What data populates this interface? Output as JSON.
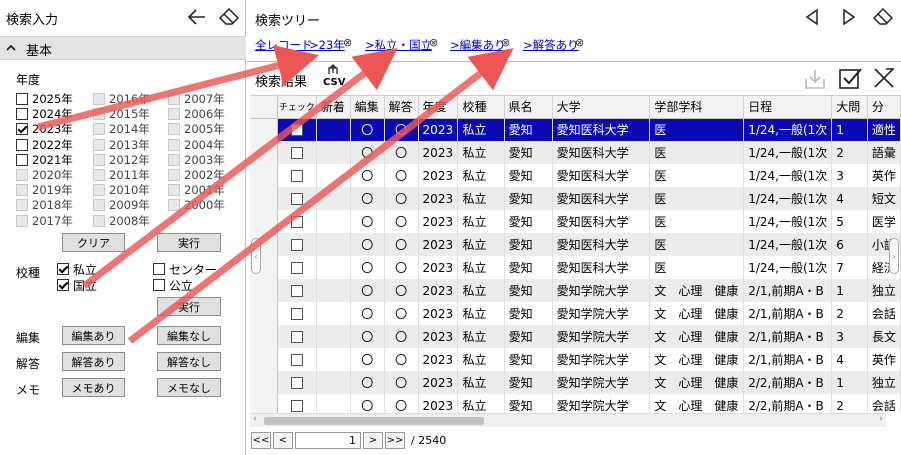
{
  "left": {
    "title": "検索入力",
    "section": "基本",
    "year_label": "年度",
    "years": [
      {
        "label": "2025年",
        "checked": false,
        "enabled": true
      },
      {
        "label": "2024年",
        "checked": false,
        "enabled": true
      },
      {
        "label": "2023年",
        "checked": true,
        "enabled": true
      },
      {
        "label": "2022年",
        "checked": false,
        "enabled": true
      },
      {
        "label": "2021年",
        "checked": false,
        "enabled": true
      },
      {
        "label": "2020年",
        "checked": false,
        "enabled": false
      },
      {
        "label": "2019年",
        "checked": false,
        "enabled": false
      },
      {
        "label": "2018年",
        "checked": false,
        "enabled": false
      },
      {
        "label": "2017年",
        "checked": false,
        "enabled": false
      },
      {
        "label": "2016年",
        "checked": false,
        "enabled": false
      },
      {
        "label": "2015年",
        "checked": false,
        "enabled": false
      },
      {
        "label": "2014年",
        "checked": false,
        "enabled": false
      },
      {
        "label": "2013年",
        "checked": false,
        "enabled": false
      },
      {
        "label": "2012年",
        "checked": false,
        "enabled": false
      },
      {
        "label": "2011年",
        "checked": false,
        "enabled": false
      },
      {
        "label": "2010年",
        "checked": false,
        "enabled": false
      },
      {
        "label": "2009年",
        "checked": false,
        "enabled": false
      },
      {
        "label": "2008年",
        "checked": false,
        "enabled": false
      },
      {
        "label": "2007年",
        "checked": false,
        "enabled": false
      },
      {
        "label": "2006年",
        "checked": false,
        "enabled": false
      },
      {
        "label": "2005年",
        "checked": false,
        "enabled": false
      },
      {
        "label": "2004年",
        "checked": false,
        "enabled": false
      },
      {
        "label": "2003年",
        "checked": false,
        "enabled": false
      },
      {
        "label": "2002年",
        "checked": false,
        "enabled": false
      },
      {
        "label": "2001年",
        "checked": false,
        "enabled": false
      },
      {
        "label": "2000年",
        "checked": false,
        "enabled": false
      }
    ],
    "clear_btn": "クリア",
    "run_btn": "実行",
    "school_label": "校種",
    "school_types": [
      {
        "label": "私立",
        "checked": true
      },
      {
        "label": "センター",
        "checked": false
      },
      {
        "label": "国立",
        "checked": true
      },
      {
        "label": "公立",
        "checked": false
      }
    ],
    "run_btn2": "実行",
    "edit_label": "編集",
    "edit_yes": "編集あり",
    "edit_no": "編集なし",
    "answer_label": "解答",
    "answer_yes": "解答あり",
    "answer_no": "解答なし",
    "memo_label": "メモ",
    "memo_yes": "メモあり",
    "memo_no": "メモなし"
  },
  "right": {
    "title": "検索ツリー",
    "breadcrumbs": [
      "全レコード",
      ">23年",
      ">私立・国立",
      ">編集あり",
      ">解答あり"
    ],
    "results_label": "検索結果",
    "csv_label": "CSV",
    "columns": [
      "チェック",
      "新着",
      "編集",
      "解答",
      "年度",
      "校種",
      "県名",
      "大学",
      "学部学科",
      "日程",
      "大問",
      "分"
    ],
    "rows": [
      {
        "new": "",
        "edit": "〇",
        "ans": "〇",
        "year": "2023",
        "type": "私立",
        "pref": "愛知",
        "univ": "愛知医科大学",
        "dept": "医",
        "sched": "1/24,一般(1次",
        "q": "1",
        "cat": "適性"
      },
      {
        "new": "",
        "edit": "〇",
        "ans": "〇",
        "year": "2023",
        "type": "私立",
        "pref": "愛知",
        "univ": "愛知医科大学",
        "dept": "医",
        "sched": "1/24,一般(1次",
        "q": "2",
        "cat": "語彙"
      },
      {
        "new": "",
        "edit": "〇",
        "ans": "〇",
        "year": "2023",
        "type": "私立",
        "pref": "愛知",
        "univ": "愛知医科大学",
        "dept": "医",
        "sched": "1/24,一般(1次",
        "q": "3",
        "cat": "英作"
      },
      {
        "new": "",
        "edit": "〇",
        "ans": "〇",
        "year": "2023",
        "type": "私立",
        "pref": "愛知",
        "univ": "愛知医科大学",
        "dept": "医",
        "sched": "1/24,一般(1次",
        "q": "4",
        "cat": "短文"
      },
      {
        "new": "",
        "edit": "〇",
        "ans": "〇",
        "year": "2023",
        "type": "私立",
        "pref": "愛知",
        "univ": "愛知医科大学",
        "dept": "医",
        "sched": "1/24,一般(1次",
        "q": "5",
        "cat": "医学"
      },
      {
        "new": "",
        "edit": "〇",
        "ans": "〇",
        "year": "2023",
        "type": "私立",
        "pref": "愛知",
        "univ": "愛知医科大学",
        "dept": "医",
        "sched": "1/24,一般(1次",
        "q": "6",
        "cat": "小説"
      },
      {
        "new": "",
        "edit": "〇",
        "ans": "〇",
        "year": "2023",
        "type": "私立",
        "pref": "愛知",
        "univ": "愛知医科大学",
        "dept": "医",
        "sched": "1/24,一般(1次",
        "q": "7",
        "cat": "経済"
      },
      {
        "new": "",
        "edit": "〇",
        "ans": "〇",
        "year": "2023",
        "type": "私立",
        "pref": "愛知",
        "univ": "愛知学院大学",
        "dept": "文　心理　健康",
        "sched": "2/1,前期A・B",
        "q": "1",
        "cat": "独立"
      },
      {
        "new": "",
        "edit": "〇",
        "ans": "〇",
        "year": "2023",
        "type": "私立",
        "pref": "愛知",
        "univ": "愛知学院大学",
        "dept": "文　心理　健康",
        "sched": "2/1,前期A・B",
        "q": "2",
        "cat": "会話"
      },
      {
        "new": "",
        "edit": "〇",
        "ans": "〇",
        "year": "2023",
        "type": "私立",
        "pref": "愛知",
        "univ": "愛知学院大学",
        "dept": "文　心理　健康",
        "sched": "2/1,前期A・B",
        "q": "3",
        "cat": "長文"
      },
      {
        "new": "",
        "edit": "〇",
        "ans": "〇",
        "year": "2023",
        "type": "私立",
        "pref": "愛知",
        "univ": "愛知学院大学",
        "dept": "文　心理　健康",
        "sched": "2/1,前期A・B",
        "q": "4",
        "cat": "英作"
      },
      {
        "new": "",
        "edit": "〇",
        "ans": "〇",
        "year": "2023",
        "type": "私立",
        "pref": "愛知",
        "univ": "愛知学院大学",
        "dept": "文　心理　健康",
        "sched": "2/2,前期A・B",
        "q": "1",
        "cat": "独立"
      },
      {
        "new": "",
        "edit": "〇",
        "ans": "〇",
        "year": "2023",
        "type": "私立",
        "pref": "愛知",
        "univ": "愛知学院大学",
        "dept": "文　心理　健康",
        "sched": "2/2,前期A・B",
        "q": "2",
        "cat": "会話"
      }
    ],
    "pager": {
      "first": "<<",
      "prev": "<",
      "page": "1",
      "next": ">",
      "last": ">>",
      "total": "/ 2540"
    }
  },
  "colors": {
    "selection": "#0a0ab4",
    "arrow": "#ee5555",
    "link": "#0000cc"
  }
}
